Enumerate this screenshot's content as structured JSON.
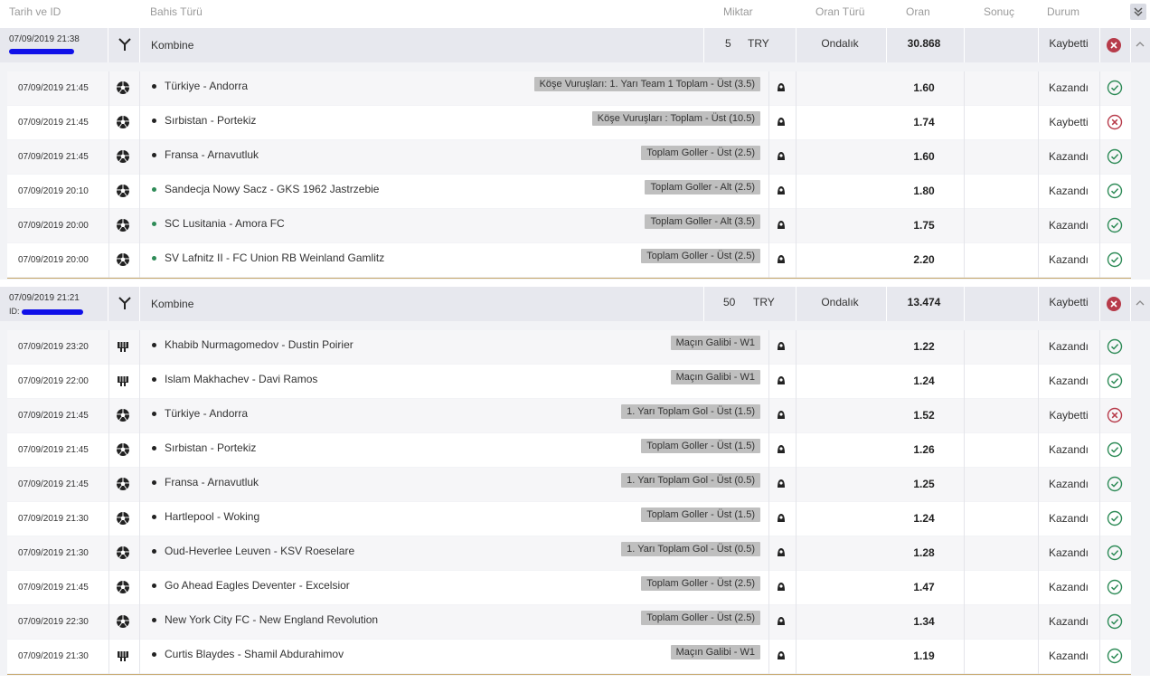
{
  "header": {
    "date_id": "Tarih ve ID",
    "bet_type": "Bahis Türü",
    "amount": "Miktar",
    "odd_type": "Oran Türü",
    "odd": "Oran",
    "result": "Sonuç",
    "status": "Durum"
  },
  "coupons": [
    {
      "datetime": "07/09/2019 21:38",
      "id_label": "",
      "type": "Kombine",
      "amount": "5",
      "currency": "TRY",
      "odd_type": "Ondalık",
      "total_odd": "30.868",
      "status": "Kaybetti",
      "lines": [
        {
          "datetime": "07/09/2019 21:45",
          "sport": "football",
          "live": false,
          "match": "Türkiye - Andorra",
          "market": "Köşe Vuruşları: 1. Yarı Team 1 Toplam - Üst (3.5)",
          "odd": "1.60",
          "status": "Kazandı",
          "won": true
        },
        {
          "datetime": "07/09/2019 21:45",
          "sport": "football",
          "live": false,
          "match": "Sırbistan - Portekiz",
          "market": "Köşe Vuruşları : Toplam - Üst (10.5)",
          "odd": "1.74",
          "status": "Kaybetti",
          "won": false
        },
        {
          "datetime": "07/09/2019 21:45",
          "sport": "football",
          "live": false,
          "match": "Fransa - Arnavutluk",
          "market": "Toplam Goller - Üst (2.5)",
          "odd": "1.60",
          "status": "Kazandı",
          "won": true
        },
        {
          "datetime": "07/09/2019 20:10",
          "sport": "football",
          "live": true,
          "match": "Sandecja Nowy Sacz - GKS 1962 Jastrzebie",
          "market": "Toplam Goller - Alt (2.5)",
          "odd": "1.80",
          "status": "Kazandı",
          "won": true
        },
        {
          "datetime": "07/09/2019 20:00",
          "sport": "football",
          "live": true,
          "match": "SC Lusitania - Amora FC",
          "market": "Toplam Goller - Alt (3.5)",
          "odd": "1.75",
          "status": "Kazandı",
          "won": true
        },
        {
          "datetime": "07/09/2019 20:00",
          "sport": "football",
          "live": true,
          "match": "SV Lafnitz II - FC Union RB Weinland Gamlitz",
          "market": "Toplam Goller - Üst (2.5)",
          "odd": "2.20",
          "status": "Kazandı",
          "won": true
        }
      ]
    },
    {
      "datetime": "07/09/2019 21:21",
      "id_label": "ID:",
      "type": "Kombine",
      "amount": "50",
      "currency": "TRY",
      "odd_type": "Ondalık",
      "total_odd": "13.474",
      "status": "Kaybetti",
      "lines": [
        {
          "datetime": "07/09/2019 23:20",
          "sport": "mma",
          "live": false,
          "match": "Khabib Nurmagomedov - Dustin Poirier",
          "market": "Maçın Galibi - W1",
          "odd": "1.22",
          "status": "Kazandı",
          "won": true
        },
        {
          "datetime": "07/09/2019 22:00",
          "sport": "mma",
          "live": false,
          "match": "Islam Makhachev - Davi Ramos",
          "market": "Maçın Galibi - W1",
          "odd": "1.24",
          "status": "Kazandı",
          "won": true
        },
        {
          "datetime": "07/09/2019 21:45",
          "sport": "football",
          "live": false,
          "match": "Türkiye - Andorra",
          "market": "1. Yarı Toplam Gol - Üst (1.5)",
          "odd": "1.52",
          "status": "Kaybetti",
          "won": false
        },
        {
          "datetime": "07/09/2019 21:45",
          "sport": "football",
          "live": false,
          "match": "Sırbistan - Portekiz",
          "market": "Toplam Goller - Üst (1.5)",
          "odd": "1.26",
          "status": "Kazandı",
          "won": true
        },
        {
          "datetime": "07/09/2019 21:45",
          "sport": "football",
          "live": false,
          "match": "Fransa - Arnavutluk",
          "market": "1. Yarı Toplam Gol - Üst (0.5)",
          "odd": "1.25",
          "status": "Kazandı",
          "won": true
        },
        {
          "datetime": "07/09/2019 21:30",
          "sport": "football",
          "live": false,
          "match": "Hartlepool - Woking",
          "market": "Toplam Goller - Üst (1.5)",
          "odd": "1.24",
          "status": "Kazandı",
          "won": true
        },
        {
          "datetime": "07/09/2019 21:30",
          "sport": "football",
          "live": false,
          "match": "Oud-Heverlee Leuven - KSV Roeselare",
          "market": "1. Yarı Toplam Gol - Üst (0.5)",
          "odd": "1.28",
          "status": "Kazandı",
          "won": true
        },
        {
          "datetime": "07/09/2019 21:45",
          "sport": "football",
          "live": false,
          "match": "Go Ahead Eagles Deventer - Excelsior",
          "market": "Toplam Goller - Üst (2.5)",
          "odd": "1.47",
          "status": "Kazandı",
          "won": true
        },
        {
          "datetime": "07/09/2019 22:30",
          "sport": "football",
          "live": false,
          "match": "New York City FC - New England Revolution",
          "market": "Toplam Goller - Üst (2.5)",
          "odd": "1.34",
          "status": "Kazandı",
          "won": true
        },
        {
          "datetime": "07/09/2019 21:30",
          "sport": "mma",
          "live": false,
          "match": "Curtis Blaydes - Shamil Abdurahimov",
          "market": "Maçın Galibi - W1",
          "odd": "1.19",
          "status": "Kazandı",
          "won": true
        }
      ]
    }
  ],
  "colors": {
    "won": "#2e8b57",
    "lost": "#b73b4a",
    "live_dot": "#2e8b57",
    "redaction": "#1010e8",
    "market_badge": "#bfbfbf",
    "coupon_header": "#e7e8ee"
  }
}
